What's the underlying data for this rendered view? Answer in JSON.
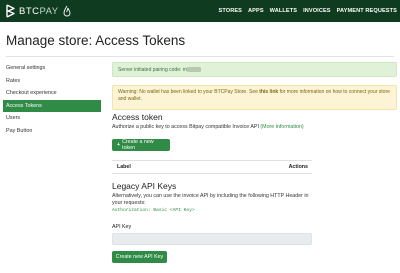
{
  "brand": {
    "name_a": "BTC",
    "name_b": "PAY",
    "accent": "#2f8b45",
    "nav_bg": "#0f3b21"
  },
  "nav": [
    {
      "label": "STORES"
    },
    {
      "label": "APPS"
    },
    {
      "label": "WALLETS"
    },
    {
      "label": "INVOICES"
    },
    {
      "label": "PAYMENT REQUESTS"
    }
  ],
  "page": {
    "title": "Manage store: Access Tokens"
  },
  "sidebar": {
    "items": [
      {
        "label": "General settings",
        "active": false
      },
      {
        "label": "Rates",
        "active": false
      },
      {
        "label": "Checkout experience",
        "active": false
      },
      {
        "label": "Access Tokens",
        "active": true
      },
      {
        "label": "Users",
        "active": false
      },
      {
        "label": "Pay Button",
        "active": false
      }
    ]
  },
  "alerts": {
    "success": "Server initiated pairing code: m",
    "warning_pre": "Warning: No wallet has been linked to your BTCPay Store. See ",
    "warning_link": "this link",
    "warning_post": " for more information on how to connect your store and wallet."
  },
  "access_token": {
    "heading": "Access token",
    "desc_pre": "Authorize a public key to access Bitpay compatible Invoice API ",
    "desc_link": "(More information)",
    "create_button": "Create a new token",
    "table": {
      "col_label": "Label",
      "col_actions": "Actions"
    }
  },
  "legacy": {
    "heading": "Legacy API Keys",
    "desc": "Alternatively, you can use the invoice API by including the following HTTP Header in your requests:",
    "code": "Authorization: Basic <API Key>",
    "api_key_label": "API Key",
    "api_key_value": "",
    "create_button": "Create new API Key"
  }
}
